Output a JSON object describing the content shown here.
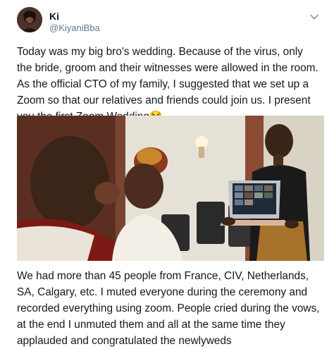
{
  "user": {
    "display_name": "Ki",
    "handle": "@KiyaniBba"
  },
  "tweet": {
    "text_top": "Today was my big bro's wedding. Because of the virus, only the bride, groom and their witnesses were allowed in the room. As the official CTO of my family, I suggested that we set up a Zoom so that our relatives and friends could join us. I present you the first Zoom Wedding😂",
    "text_bottom": "We had more than 45 people from France, CIV, Netherlands, SA, Calgary, etc. I muted everyone during the ceremony and recorded everything using zoom. People cried during the vows, at the end I unmuted them and all at the same time they applauded and congratulated the newlyweds"
  },
  "icons": {
    "menu": "chevron-down-icon",
    "avatar": "avatar-photo"
  },
  "colors": {
    "text": "#14171a",
    "secondary": "#657786"
  }
}
